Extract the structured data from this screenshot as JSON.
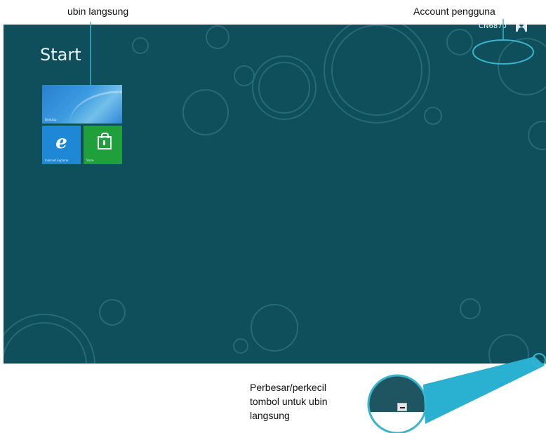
{
  "callouts": {
    "live_tiles": "ubin langsung",
    "user_account": "Account pengguna",
    "zoom_caption_lines": [
      "Perbesar/perkecil",
      "tombol untuk ubin",
      "langsung"
    ]
  },
  "start_screen": {
    "title": "Start",
    "account_name": "CN6870",
    "background_color": "#0f4f5c",
    "tiles": [
      {
        "label": "Desktop",
        "color": "#2a7fd0",
        "icon": "desktop-wallpaper"
      },
      {
        "label": "Internet Explorer",
        "color": "#1e88d6",
        "icon": "ie-icon",
        "glyph": "e"
      },
      {
        "label": "Store",
        "color": "#1fa03b",
        "icon": "store-icon"
      }
    ]
  },
  "colors": {
    "callout": "#39b4cc",
    "callout_fill": "#2ab1d1"
  }
}
